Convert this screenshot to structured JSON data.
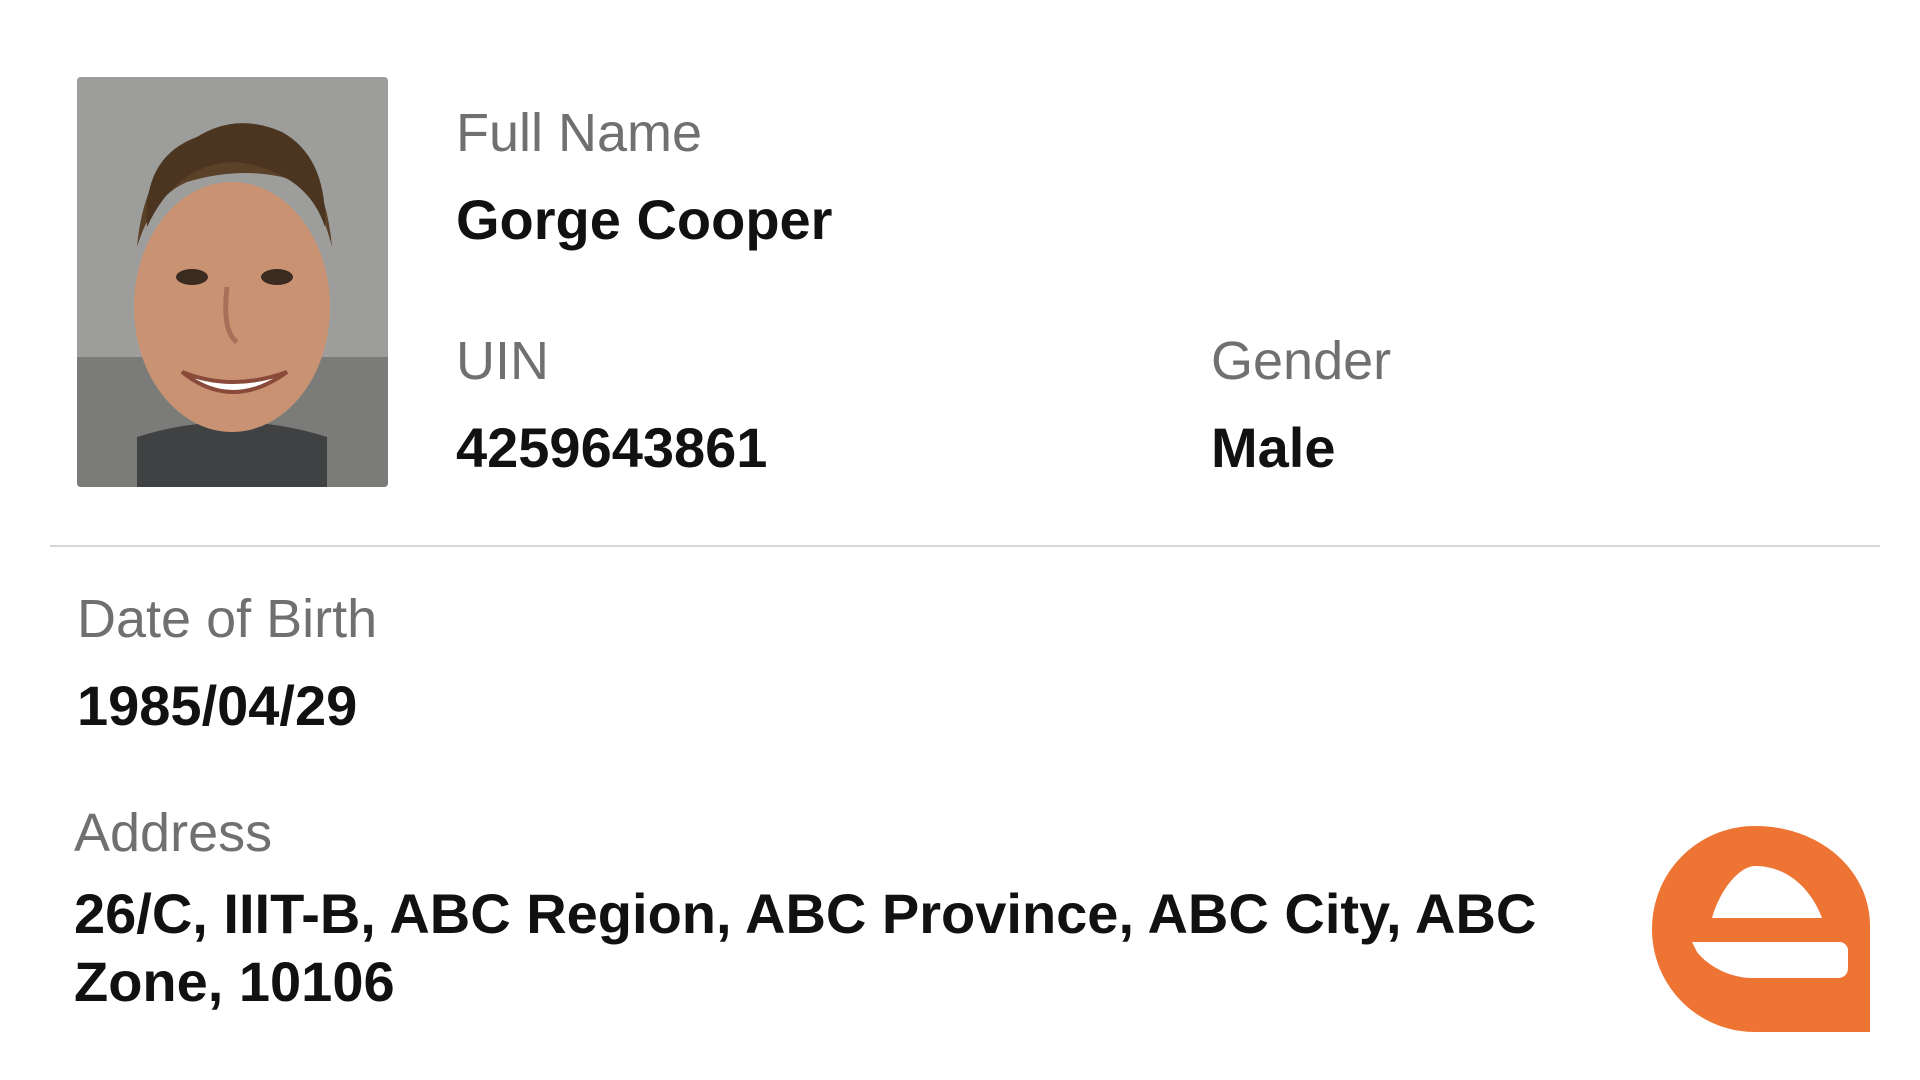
{
  "profile": {
    "full_name_label": "Full Name",
    "full_name_value": "Gorge Cooper",
    "uin_label": "UIN",
    "uin_value": "4259643861",
    "gender_label": "Gender",
    "gender_value": "Male",
    "dob_label": "Date of Birth",
    "dob_value": "1985/04/29",
    "address_label": "Address",
    "address_value": "26/C, IIIT-B, ABC Region, ABC Province, ABC City, ABC Zone, 10106"
  },
  "icons": {
    "photo": "user-photo",
    "logo": "brand-logo-icon"
  },
  "colors": {
    "label": "#707070",
    "value": "#111111",
    "divider": "#d6d6d6",
    "logo": "#ee7433"
  }
}
